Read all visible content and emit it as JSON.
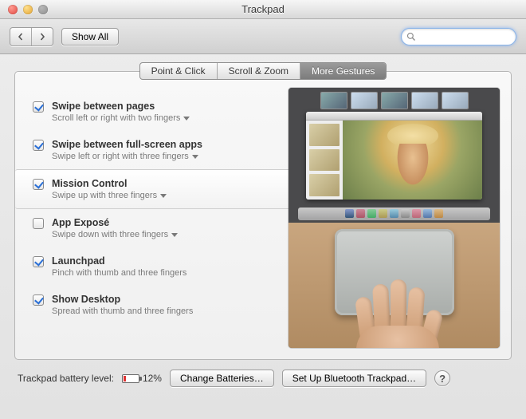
{
  "window": {
    "title": "Trackpad"
  },
  "toolbar": {
    "show_all": "Show All",
    "search_placeholder": ""
  },
  "tabs": {
    "items": [
      "Point & Click",
      "Scroll & Zoom",
      "More Gestures"
    ]
  },
  "gestures": [
    {
      "label": "Swipe between pages",
      "desc": "Scroll left or right with two fingers",
      "checked": true,
      "dropdown": true,
      "selected": false
    },
    {
      "label": "Swipe between full-screen apps",
      "desc": "Swipe left or right with three fingers",
      "checked": true,
      "dropdown": true,
      "selected": false
    },
    {
      "label": "Mission Control",
      "desc": "Swipe up with three fingers",
      "checked": true,
      "dropdown": true,
      "selected": true
    },
    {
      "label": "App Exposé",
      "desc": "Swipe down with three fingers",
      "checked": false,
      "dropdown": true,
      "selected": false
    },
    {
      "label": "Launchpad",
      "desc": "Pinch with thumb and three fingers",
      "checked": true,
      "dropdown": false,
      "selected": false
    },
    {
      "label": "Show Desktop",
      "desc": "Spread with thumb and three fingers",
      "checked": true,
      "dropdown": false,
      "selected": false
    }
  ],
  "footer": {
    "battery_label": "Trackpad battery level:",
    "battery_pct": "12%",
    "change_batteries": "Change Batteries…",
    "setup_bt": "Set Up Bluetooth Trackpad…",
    "help": "?"
  }
}
